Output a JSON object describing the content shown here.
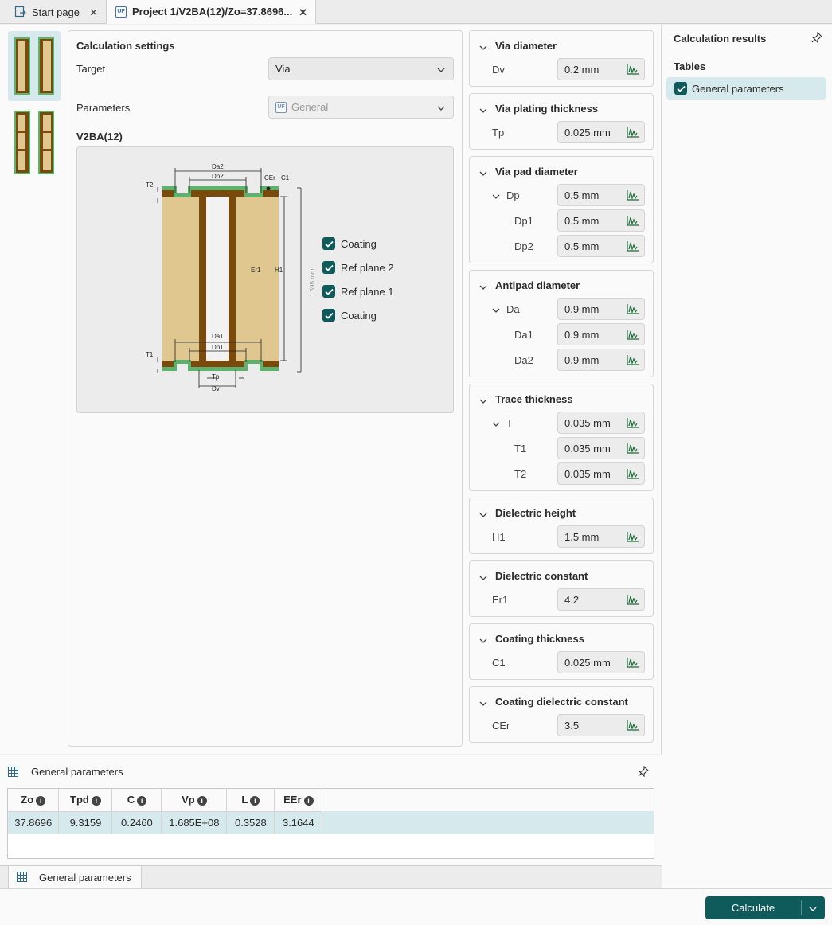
{
  "tabs": [
    {
      "label": "Start page"
    },
    {
      "label": "Project 1/V2BA(12)/Zo=37.8696..."
    }
  ],
  "settings": {
    "title": "Calculation settings",
    "target_label": "Target",
    "target_value": "Via",
    "parameters_label": "Parameters",
    "parameters_value": "General",
    "structure_title": "V2BA(12)"
  },
  "diagram": {
    "labels": {
      "Da2": "Da2",
      "Dp2": "Dp2",
      "CEr": "CEr",
      "C1": "C1",
      "T2": "T2",
      "Er1": "Er1",
      "H1": "H1",
      "height": "1.595 mm",
      "Da1": "Da1",
      "Dp1": "Dp1",
      "T1": "T1",
      "Tp": "Tp",
      "Dv": "Dv"
    },
    "layers": [
      {
        "label": "Coating",
        "checked": true
      },
      {
        "label": "Ref plane 2",
        "checked": true
      },
      {
        "label": "Ref plane 1",
        "checked": true
      },
      {
        "label": "Coating",
        "checked": true
      }
    ]
  },
  "param_groups": [
    {
      "title": "Via diameter",
      "rows": [
        {
          "label": "Dv",
          "value": "0.2 mm"
        }
      ]
    },
    {
      "title": "Via plating thickness",
      "rows": [
        {
          "label": "Tp",
          "value": "0.025 mm"
        }
      ]
    },
    {
      "title": "Via pad diameter",
      "rows": [
        {
          "label": "Dp",
          "value": "0.5 mm"
        },
        {
          "label": "Dp1",
          "value": "0.5 mm"
        },
        {
          "label": "Dp2",
          "value": "0.5 mm"
        }
      ]
    },
    {
      "title": "Antipad diameter",
      "rows": [
        {
          "label": "Da",
          "value": "0.9 mm"
        },
        {
          "label": "Da1",
          "value": "0.9 mm"
        },
        {
          "label": "Da2",
          "value": "0.9 mm"
        }
      ]
    },
    {
      "title": "Trace thickness",
      "rows": [
        {
          "label": "T",
          "value": "0.035 mm"
        },
        {
          "label": "T1",
          "value": "0.035 mm"
        },
        {
          "label": "T2",
          "value": "0.035 mm"
        }
      ]
    },
    {
      "title": "Dielectric height",
      "rows": [
        {
          "label": "H1",
          "value": "1.5 mm"
        }
      ]
    },
    {
      "title": "Dielectric constant",
      "rows": [
        {
          "label": "Er1",
          "value": "4.2"
        }
      ]
    },
    {
      "title": "Coating thickness",
      "rows": [
        {
          "label": "C1",
          "value": "0.025 mm"
        }
      ]
    },
    {
      "title": "Coating dielectric constant",
      "rows": [
        {
          "label": "CEr",
          "value": "3.5"
        }
      ]
    }
  ],
  "results": {
    "title": "Calculation results",
    "tables_label": "Tables",
    "items": [
      {
        "label": "General parameters",
        "checked": true
      }
    ]
  },
  "bottom_panel": {
    "title": "General parameters",
    "columns": [
      "Zo",
      "Tpd",
      "C",
      "Vp",
      "L",
      "EEr"
    ],
    "rows": [
      [
        "37.8696",
        "9.3159",
        "0.2460",
        "1.685E+08",
        "0.3528",
        "3.1644"
      ]
    ],
    "tab_label": "General parameters"
  },
  "footer": {
    "calculate_label": "Calculate"
  },
  "colors": {
    "accent": "#0f5a5a",
    "selected_bg": "#d6e9ec",
    "dielectric": "#dfc78f",
    "copper": "#7a4a0c",
    "coating": "#5db36b"
  }
}
